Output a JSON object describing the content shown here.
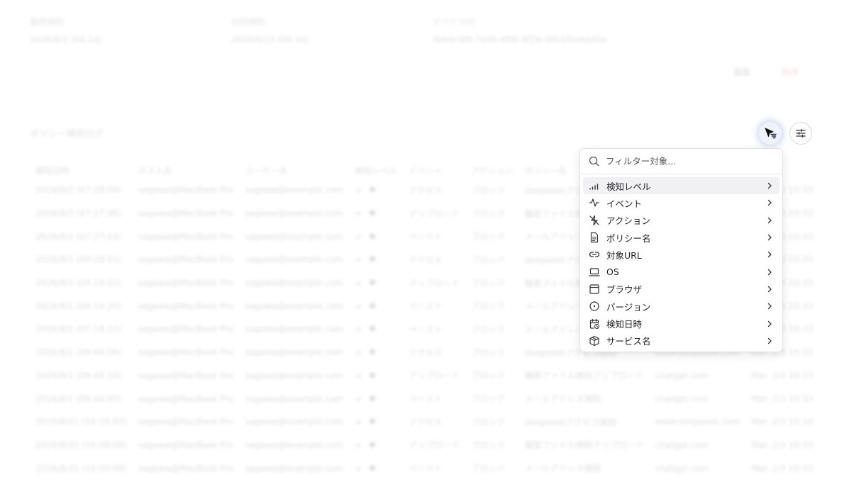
{
  "background": {
    "info": [
      {
        "label": "最終検知",
        "value": "2026/8/2 (04:14)"
      },
      {
        "label": "初回検知",
        "value": "2026/6/23 (09:33)"
      },
      {
        "label": "デバイスID",
        "value": "3b64c4f8-7ad0-4f0b-8f29-d0b1f2e6d45a"
      }
    ],
    "header_buttons": [
      "編集",
      "削除"
    ],
    "section_title": "ポリシー検知ログ",
    "table": {
      "columns": [
        "検知日時",
        "ホスト名",
        "ユーザー名",
        "検知レベル",
        "イベント",
        "アクション",
        "ポリシー名",
        "",
        ""
      ],
      "rows": [
        [
          "2026/8/2 (07:28:09)",
          "sagawa@MacBook Pro",
          "sagawa@example.com",
          "アクセス",
          "ブロック",
          "deepseekアクセス検知",
          "",
          "Mar. 2/3 10:33"
        ],
        [
          "2026/8/2 (07:27:36)",
          "sagawa@MacBook Pro",
          "sagawa@example.com",
          "アップロード",
          "ブロック",
          "機密ファイル検知アップロード",
          "",
          "Mar. 2/3 10:33"
        ],
        [
          "2026/8/2 (07:27:24)",
          "sagawa@MacBook Pro",
          "sagawa@example.com",
          "ペースト",
          "ブロック",
          "メールアドレス検知",
          "",
          "Mar. 2/3 10:33"
        ],
        [
          "2026/8/1 (09:28:21)",
          "sagawa@MacBook Pro",
          "sagawa@example.com",
          "アクセス",
          "ブロック",
          "deepseekアクセス検知",
          "",
          "Mar. 2/3 10:33"
        ],
        [
          "2026/8/1 (04:14:51)",
          "sagawa@MacBook Pro",
          "sagawa@example.com",
          "アップロード",
          "ブロック",
          "機密ファイル検知アップロード",
          "",
          "Mar. 2/3 10:33"
        ],
        [
          "2026/8/1 (04:14:20)",
          "sagawa@MacBook Pro",
          "sagawa@example.com",
          "ペースト",
          "ブロック",
          "メールアドレス検知",
          "",
          "Mar. 2/3 10:33"
        ],
        [
          "2026/8/1 (07:14:12)",
          "sagawa@MacBook Pro",
          "sagawa@example.com",
          "ペースト",
          "ブロック",
          "メールアドレス検知",
          "",
          "Mar. 2/3 10:33"
        ],
        [
          "2026/8/1 (09:44:58)",
          "sagawa@MacBook Pro",
          "sagawa@example.com",
          "アクセス",
          "ブロック",
          "deepseekアクセス検知",
          "www.deepseek.com",
          "Mar. 2/3 10:33"
        ],
        [
          "2026/8/1 (09:44:15)",
          "sagawa@MacBook Pro",
          "sagawa@example.com",
          "アップロード",
          "ブロック",
          "機密ファイル検知アップロード",
          "chatgpt.com",
          "Mar. 2/3 10:33"
        ],
        [
          "2026/8/1 (09:44:05)",
          "sagawa@MacBook Pro",
          "sagawa@example.com",
          "ペースト",
          "ブロック",
          "メールアドレス検知",
          "chatgpt.com",
          "Mar. 2/3 10:33"
        ],
        [
          "2026/8/31 (16:16:43)",
          "sagawa@MacBook Pro",
          "sagawa@example.com",
          "アクセス",
          "ブロック",
          "deepseekアクセス検知",
          "www.deepseek.com",
          "Mar. 2/3 10:33"
        ],
        [
          "2026/8/31 (16:28:08)",
          "sagawa@MacBook Pro",
          "sagawa@example.com",
          "アップロード",
          "ブロック",
          "機密ファイル検知アップロード",
          "chatgpt.com",
          "Mar. 2/3 10:33"
        ],
        [
          "2026/8/31 (16:29:08)",
          "sagawa@MacBook Pro",
          "sagawa@example.com",
          "ペースト",
          "ブロック",
          "メールアドレス検知",
          "chatgpt.com",
          "Mar. 2/3 10:33"
        ]
      ]
    }
  },
  "filter_menu": {
    "search_placeholder": "フィルター対象...",
    "items": [
      {
        "label": "検知レベル",
        "icon": "signal-bars-icon",
        "highlighted": true
      },
      {
        "label": "イベント",
        "icon": "activity-icon"
      },
      {
        "label": "アクション",
        "icon": "zap-off-icon"
      },
      {
        "label": "ポリシー名",
        "icon": "document-icon"
      },
      {
        "label": "対象URL",
        "icon": "link-icon"
      },
      {
        "label": "OS",
        "icon": "laptop-icon"
      },
      {
        "label": "ブラウザ",
        "icon": "browser-window-icon"
      },
      {
        "label": "バージョン",
        "icon": "circle-dot-icon"
      },
      {
        "label": "検知日時",
        "icon": "calendar-clock-icon"
      },
      {
        "label": "サービス名",
        "icon": "package-icon"
      }
    ]
  },
  "colors": {
    "accent": "#1f2a44",
    "highlight": "#f1f1f3",
    "border": "#e2e2e6"
  }
}
